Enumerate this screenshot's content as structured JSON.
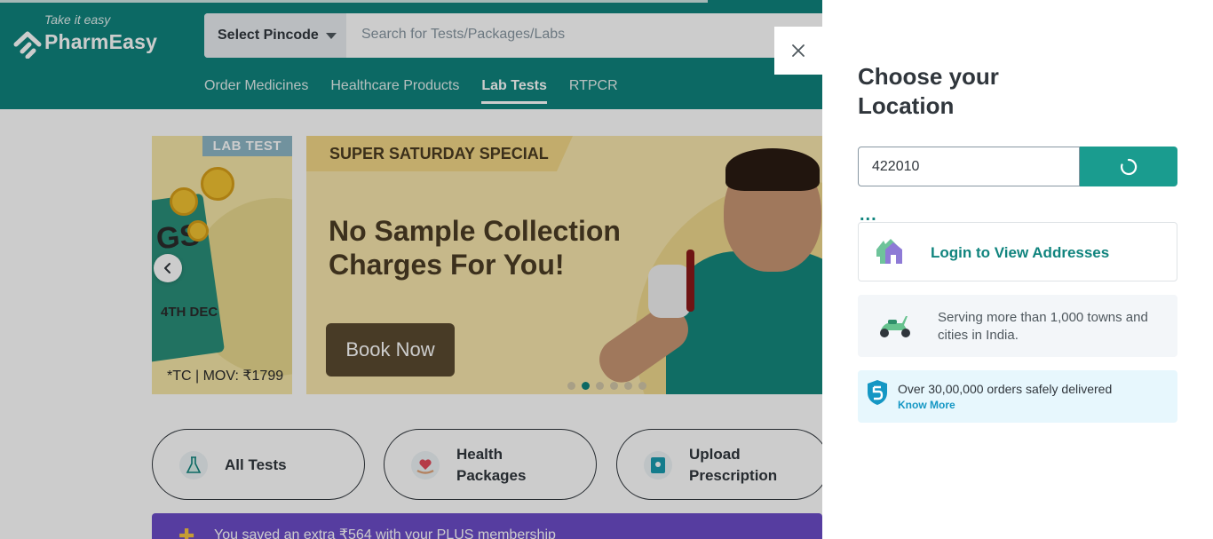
{
  "header": {
    "logo_tagline": "Take it easy",
    "logo_text": "PharmEasy",
    "pincode_label": "Select Pincode",
    "search_placeholder": "Search for Tests/Packages/Labs",
    "nav": [
      {
        "label": "Order Medicines",
        "active": false
      },
      {
        "label": "Healthcare Products",
        "active": false
      },
      {
        "label": "Lab Tests",
        "active": true
      },
      {
        "label": "RTPCR",
        "active": false
      }
    ]
  },
  "banner_left": {
    "tag": "LAB TEST",
    "board_text": "GS",
    "board_date": "4TH DEC",
    "fine_print": "*TC | MOV: ₹1799"
  },
  "banner_main": {
    "ribbon": "SUPER SATURDAY SPECIAL",
    "headline_line1": "No Sample Collection",
    "headline_line2": "Charges For You!",
    "cta": "Book Now",
    "slide_count": 6,
    "active_slide": 2
  },
  "categories": [
    {
      "line1": "All Tests",
      "line2": ""
    },
    {
      "line1": "Health",
      "line2": "Packages"
    },
    {
      "line1": "Upload",
      "line2": "Prescription"
    }
  ],
  "plus_bar": {
    "text": "You saved an extra ₹564 with your PLUS membership"
  },
  "drawer": {
    "title": "Choose your Location",
    "pincode_value": "422010",
    "loading_text": "...",
    "login_label": "Login to View Addresses",
    "serve_text": "Serving more than 1,000 towns and cities in India.",
    "orders_text": "Over 30,00,000 orders safely delivered",
    "orders_link": "Know More"
  },
  "colors": {
    "brand": "#10847e",
    "button": "#1a9c8f",
    "plus": "#6c4dc8",
    "link": "#1597c4"
  },
  "icons": [
    "close-icon",
    "spinner-icon",
    "house-icon",
    "scooter-icon",
    "shield-5-icon",
    "chevron-left-icon",
    "flask-icon",
    "hand-heart-icon",
    "prescription-icon",
    "plus-icon"
  ]
}
